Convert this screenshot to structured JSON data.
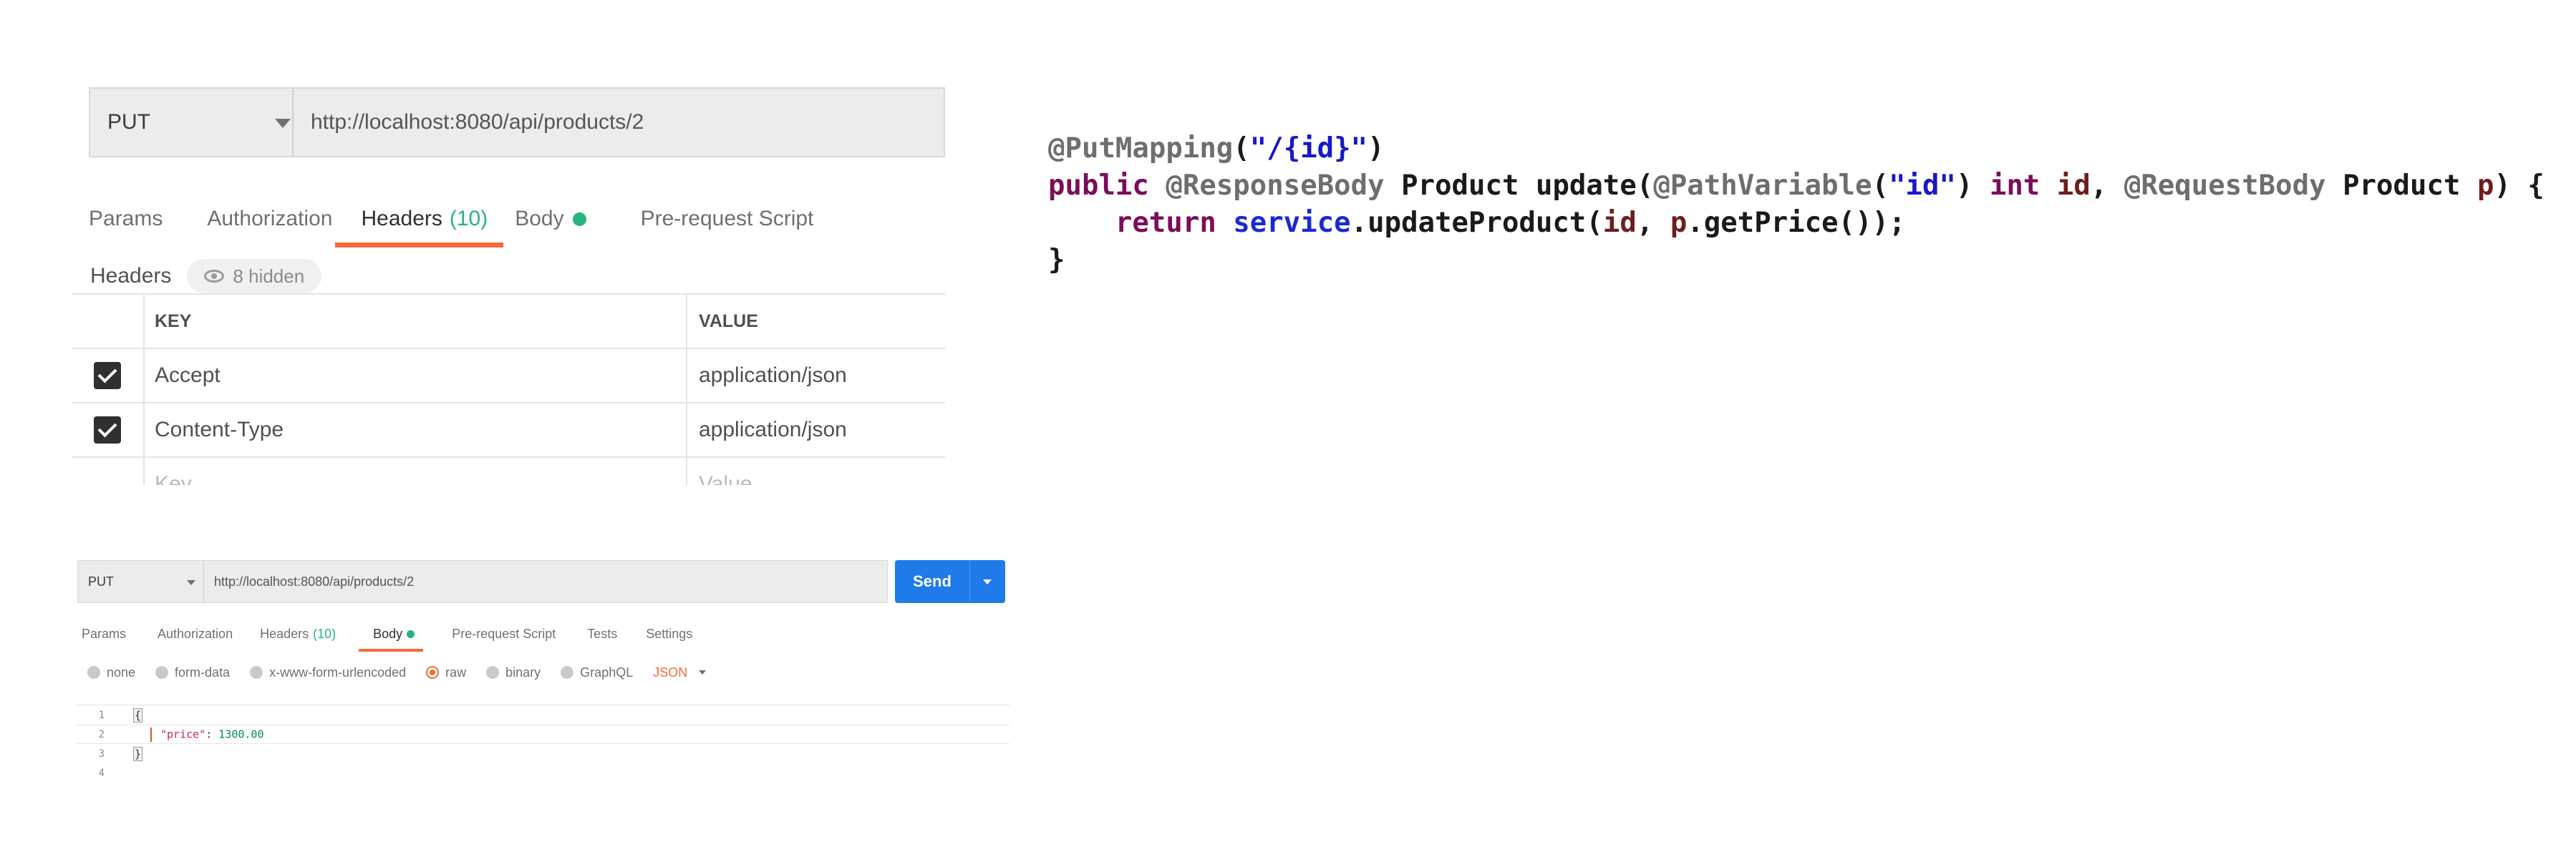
{
  "top_panel": {
    "method": "PUT",
    "url": "http://localhost:8080/api/products/2",
    "tabs": [
      {
        "label": "Params"
      },
      {
        "label": "Authorization"
      },
      {
        "label": "Headers",
        "count": "(10)"
      },
      {
        "label": "Body"
      },
      {
        "label": "Pre-request Script"
      }
    ],
    "headers_title": "Headers",
    "hidden_count": "8 hidden",
    "table": {
      "key_header": "KEY",
      "value_header": "VALUE",
      "rows": [
        {
          "key": "Accept",
          "value": "application/json",
          "checked": true
        },
        {
          "key": "Content-Type",
          "value": "application/json",
          "checked": true
        }
      ],
      "placeholder_key": "Key",
      "placeholder_value": "Value"
    }
  },
  "bottom_panel": {
    "method": "PUT",
    "url": "http://localhost:8080/api/products/2",
    "send_label": "Send",
    "tabs": [
      {
        "label": "Params"
      },
      {
        "label": "Authorization"
      },
      {
        "label": "Headers",
        "count": "(10)"
      },
      {
        "label": "Body"
      },
      {
        "label": "Pre-request Script"
      },
      {
        "label": "Tests"
      },
      {
        "label": "Settings"
      }
    ],
    "body_types": [
      "none",
      "form-data",
      "x-www-form-urlencoded",
      "raw",
      "binary",
      "GraphQL"
    ],
    "selected_body_type": "raw",
    "format": "JSON",
    "editor": {
      "line_numbers": [
        "1",
        "2",
        "3",
        "4"
      ],
      "open_brace": "{",
      "close_brace": "}",
      "json_key": "\"price\"",
      "json_colon": ": ",
      "json_value": "1300.00"
    }
  },
  "code": {
    "annotation_put": "@PutMapping",
    "path_string": "\"/{id}\"",
    "kw_public": "public",
    "annotation_response": "@ResponseBody",
    "type_product": "Product",
    "method_name": "update",
    "annotation_path_var": "@PathVariable",
    "id_string": "\"id\"",
    "kw_int": "int",
    "param_id": "id",
    "annotation_request": "@RequestBody",
    "type_product2": "Product",
    "param_p": "p",
    "open_brace": "{",
    "kw_return": "return",
    "service": "service",
    "call_update": ".updateProduct(",
    "arg_id": "id",
    "arg_p": "p",
    "call_get_price": ".getPrice());",
    "close_brace": "}"
  },
  "colors": {
    "accent_orange": "#f26b3a",
    "accent_green": "#26b47f",
    "send_blue": "#1f7bea"
  }
}
